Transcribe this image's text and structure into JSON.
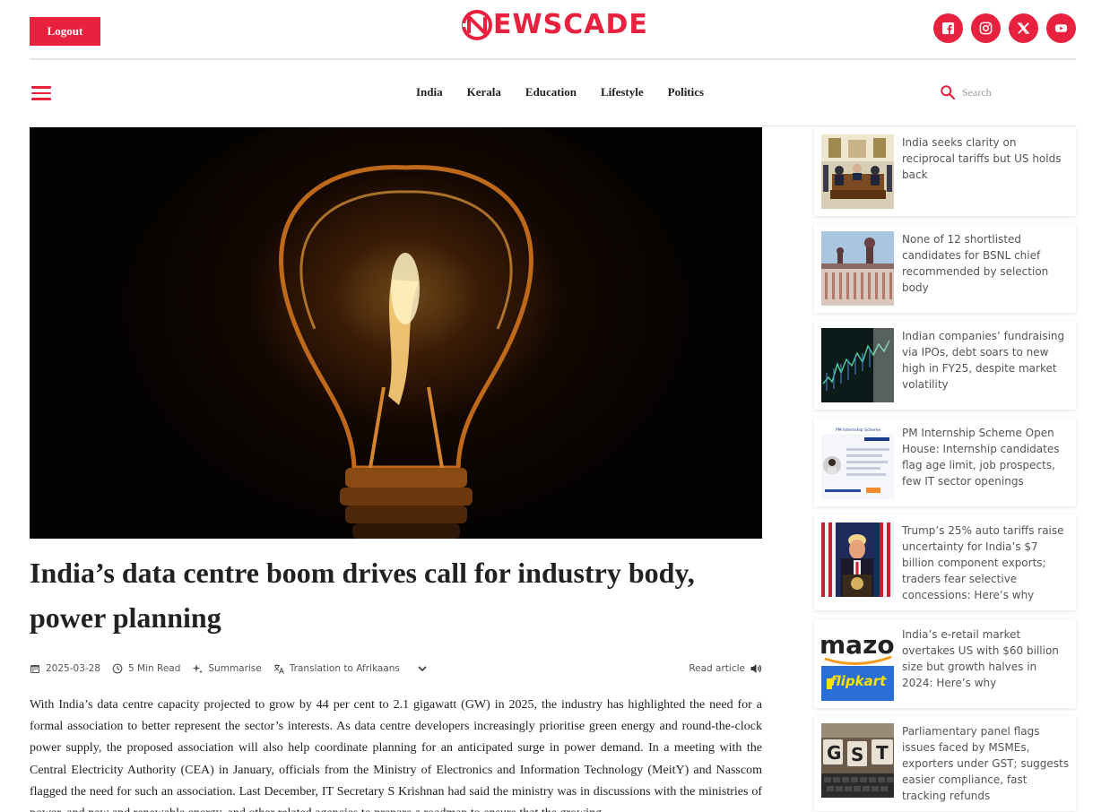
{
  "header": {
    "logout_label": "Logout",
    "logo_text_1": "EWS",
    "logo_text_2": "C",
    "logo_text_3": "ADE",
    "brand_color": "#e8213f",
    "socials": [
      "facebook-icon",
      "instagram-icon",
      "x-icon",
      "youtube-icon"
    ]
  },
  "nav": {
    "items": [
      "India",
      "Kerala",
      "Education",
      "Lifestyle",
      "Politics"
    ],
    "search_placeholder": "Search"
  },
  "article": {
    "title": "India’s data centre boom drives call for industry body, power planning",
    "date": "2025-03-28",
    "read_time": "5 Min Read",
    "summarise_label": "Summarise",
    "translation_label": "Translation to Afrikaans",
    "read_article_label": "Read article",
    "body": "With India’s data centre capacity projected to grow by 44 per cent to 2.1 gigawatt (GW) in 2025, the industry has highlighted the need for a formal association to better represent the sector’s interests. As data centre developers increasingly prioritise green energy and round-the-clock power supply, the proposed association will also help coordinate planning for an anticipated surge in power demand. In a meeting with the Central Electricity Authority (CEA) in January, officials from the Ministry of Electronics and Information Technology (MeitY) and Nasscom flagged the need for such an association. Last December, IT Secretary S Krishnan had said the ministry was in discussions with the ministries of power, and new and renewable energy, and other related agencies to prepare a roadmap to ensure that the growing"
  },
  "sidebar": {
    "stories": [
      {
        "headline": "India seeks clarity on reciprocal tariffs but US holds back"
      },
      {
        "headline": "None of 12 shortlisted candidates for BSNL chief recommended by selection body"
      },
      {
        "headline": "Indian companies’ fundraising via IPOs, debt soars to new high in FY25, despite market volatility"
      },
      {
        "headline": "PM Internship Scheme Open House: Internship candidates flag age limit, job prospects, few IT sector openings"
      },
      {
        "headline": "Trump’s 25% auto tariffs raise uncertainty for India’s $7 billion component exports; traders fear selective concessions: Here’s why"
      },
      {
        "headline": "India’s e-retail market overtakes US with $60 billion size but growth halves in 2024: Here’s why"
      },
      {
        "headline": "Parliamentary panel flags issues faced by MSMEs, exporters under GST; suggests easier compliance, fast tracking refunds"
      }
    ]
  },
  "thumb_text": {
    "amazon": "mazo",
    "flipkart": "flipkart",
    "gst": [
      "G",
      "S",
      "T"
    ],
    "internship": "PM Internship Scheme"
  }
}
